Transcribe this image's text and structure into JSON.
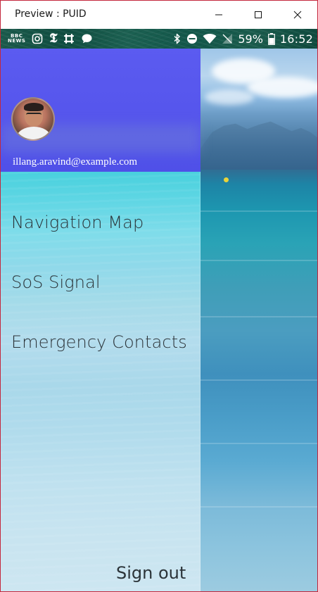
{
  "window": {
    "title": "Preview : PUID",
    "border_color": "#c4283d"
  },
  "statusbar": {
    "left_icons": [
      "bbc-news-icon",
      "instagram-icon",
      "nyt-icon",
      "slack-icon",
      "chat-bubble-icon"
    ],
    "bbc_top": "BBC",
    "bbc_bottom": "NEWS",
    "nyt_glyph": "𝕿",
    "right_icons": [
      "bluetooth-icon",
      "do-not-disturb-icon",
      "wifi-icon",
      "no-sim-icon",
      "battery-icon"
    ],
    "battery_percent": "59%",
    "time": "16:52"
  },
  "drawer": {
    "header_color": "#5555ec",
    "email": "illang.aravind@example.com",
    "nav_items": [
      {
        "label": "Navigation Map"
      },
      {
        "label": "SoS Signal"
      },
      {
        "label": "Emergency Contacts"
      }
    ],
    "signout_label": "Sign out"
  }
}
